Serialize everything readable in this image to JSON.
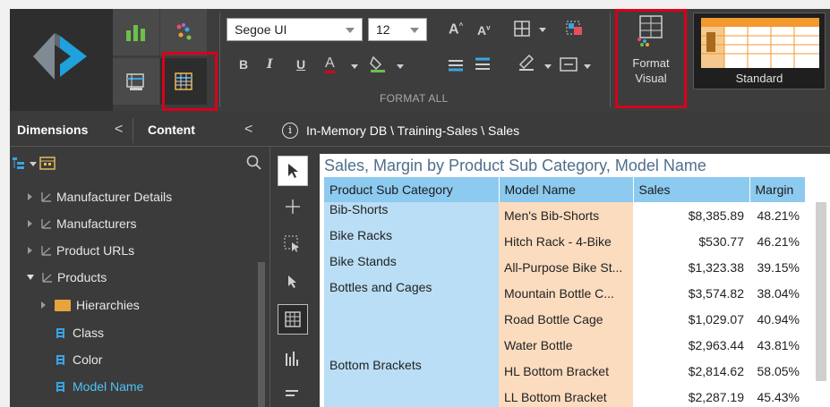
{
  "ribbon": {
    "font_family": "Segoe UI",
    "font_size": "12",
    "bold": "B",
    "italic": "I",
    "underline": "U",
    "font_color_glyph": "A",
    "grow_font_glyph": "A",
    "shrink_font_glyph": "A",
    "group_label": "FORMAT ALL",
    "format_visual_line1": "Format",
    "format_visual_line2": "Visual",
    "standard_label": "Standard"
  },
  "panel": {
    "tab_dimensions": "Dimensions",
    "tab_content": "Content",
    "collapse_glyph": "<",
    "content_collapse_glyph": "<",
    "tree": [
      {
        "label": "Manufacturer Details",
        "type": "dimension",
        "expanded": false
      },
      {
        "label": "Manufacturers",
        "type": "dimension",
        "expanded": false
      },
      {
        "label": "Product URLs",
        "type": "dimension",
        "expanded": false
      },
      {
        "label": "Products",
        "type": "dimension",
        "expanded": true
      },
      {
        "label": "Hierarchies",
        "type": "folder",
        "expanded": false
      },
      {
        "label": "Class",
        "type": "hierarchy"
      },
      {
        "label": "Color",
        "type": "hierarchy"
      },
      {
        "label": "Model Name",
        "type": "hierarchy",
        "active": true
      }
    ]
  },
  "breadcrumb": {
    "info_glyph": "i",
    "path": "In-Memory DB \\ Training-Sales \\ Sales"
  },
  "grid": {
    "title": "Sales, Margin by Product Sub Category, Model Name",
    "columns": [
      "Product Sub Category",
      "Model Name",
      "Sales",
      "Margin"
    ],
    "rows": [
      {
        "category": "Bib-Shorts",
        "model": "Men's Bib-Shorts",
        "sales": "$8,385.89",
        "margin": "48.21%"
      },
      {
        "category": "Bike Racks",
        "model": "Hitch Rack - 4-Bike",
        "sales": "$530.77",
        "margin": "46.21%"
      },
      {
        "category": "Bike Stands",
        "model": "All-Purpose Bike St...",
        "sales": "$1,323.38",
        "margin": "39.15%"
      },
      {
        "category": "Bottles and Cages",
        "model": "Mountain Bottle C...",
        "sales": "$3,574.82",
        "margin": "38.04%"
      },
      {
        "category": "",
        "model": "Road Bottle Cage",
        "sales": "$1,029.07",
        "margin": "40.94%"
      },
      {
        "category": "",
        "model": "Water Bottle",
        "sales": "$2,963.44",
        "margin": "43.81%"
      },
      {
        "category": "Bottom Brackets",
        "model": "HL Bottom Bracket",
        "sales": "$2,814.62",
        "margin": "58.05%"
      },
      {
        "category": "",
        "model": "LL Bottom Bracket",
        "sales": "$2,287.19",
        "margin": "45.43%"
      }
    ]
  },
  "colors": {
    "highlight_red": "#d9001b",
    "header_blue": "#8dcaf0",
    "category_blue": "#b9def5",
    "model_peach": "#fbdcbf",
    "active_tree_item": "#4fc3f7",
    "title_color": "#4f6f8c"
  }
}
